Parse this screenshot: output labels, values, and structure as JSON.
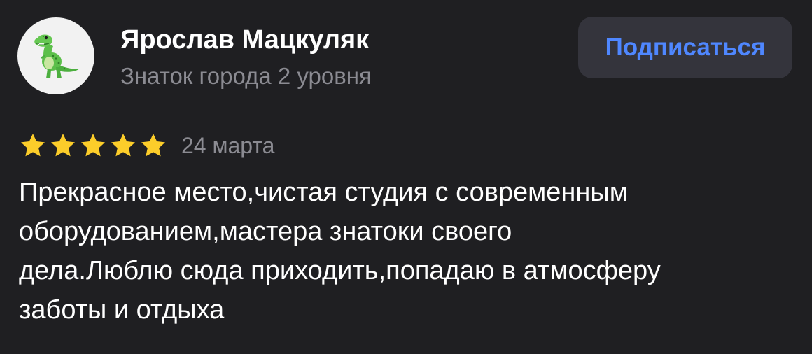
{
  "review": {
    "author": {
      "name": "Ярослав Мацкуляк",
      "level": "Знаток города 2 уровня",
      "avatar_icon": "dinosaur-icon"
    },
    "subscribe_label": "Подписаться",
    "rating": 5,
    "rating_max": 5,
    "date": "24 марта",
    "text_lines": [
      "Прекрасное место,чистая студия с современным",
      "оборудованием,мастера знатоки своего",
      "дела.Люблю сюда приходить,попадаю в атмосферу",
      "заботы и отдыха"
    ]
  },
  "colors": {
    "background": "#1f1f22",
    "button_background": "#34343c",
    "accent_blue": "#4f87ff",
    "secondary_text": "#8b8b92",
    "star": "#fccd2a"
  }
}
